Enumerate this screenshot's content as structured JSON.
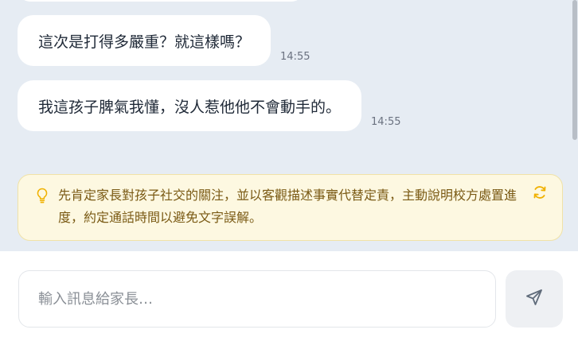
{
  "messages": [
    {
      "text": "這次是打得多嚴重？就這樣嗎？",
      "time": "14:55"
    },
    {
      "text": "我這孩子脾氣我懂，沒人惹他他不會動手的。",
      "time": "14:55"
    }
  ],
  "suggestion": {
    "text": "先肯定家長對孩子社交的關注，並以客觀描述事實代替定責，主動說明校方處置進度，約定通話時間以避免文字誤解。",
    "icon": "lightbulb-icon",
    "action_icon": "refresh-icon"
  },
  "composer": {
    "placeholder": "輸入訊息給家長…",
    "send_icon": "send-icon"
  },
  "colors": {
    "chat_bg": "#e6ecf3",
    "suggestion_bg": "#fdf8e1",
    "suggestion_text": "#7a5a14",
    "accent": "#f0b100"
  }
}
